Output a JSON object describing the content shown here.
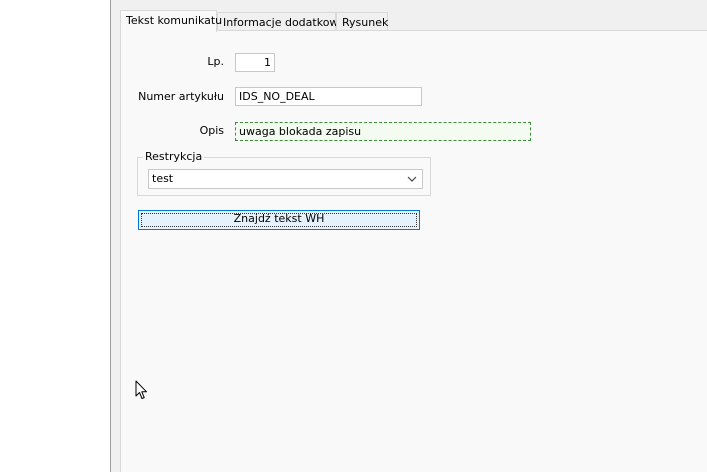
{
  "tabs": [
    {
      "label": "Tekst komunikatu",
      "active": true
    },
    {
      "label": "Informacje dodatkowe",
      "active": false
    },
    {
      "label": "Rysunek",
      "active": false
    }
  ],
  "form": {
    "lp": {
      "label": "Lp.",
      "value": "1"
    },
    "numer_artykulu": {
      "label": "Numer artykułu",
      "value": "IDS_NO_DEAL"
    },
    "opis": {
      "label": "Opis",
      "value": "uwaga blokada zapisu"
    },
    "restrykcja": {
      "label": "Restrykcja",
      "value": "test"
    },
    "find_button": {
      "label": "Znajdź tekst WH"
    }
  },
  "icons": {
    "dropdown": "chevron-down-icon",
    "cursor": "mouse-pointer-icon"
  },
  "colors": {
    "accent": "#0078d7",
    "focus_border": "#3c8c3c"
  }
}
